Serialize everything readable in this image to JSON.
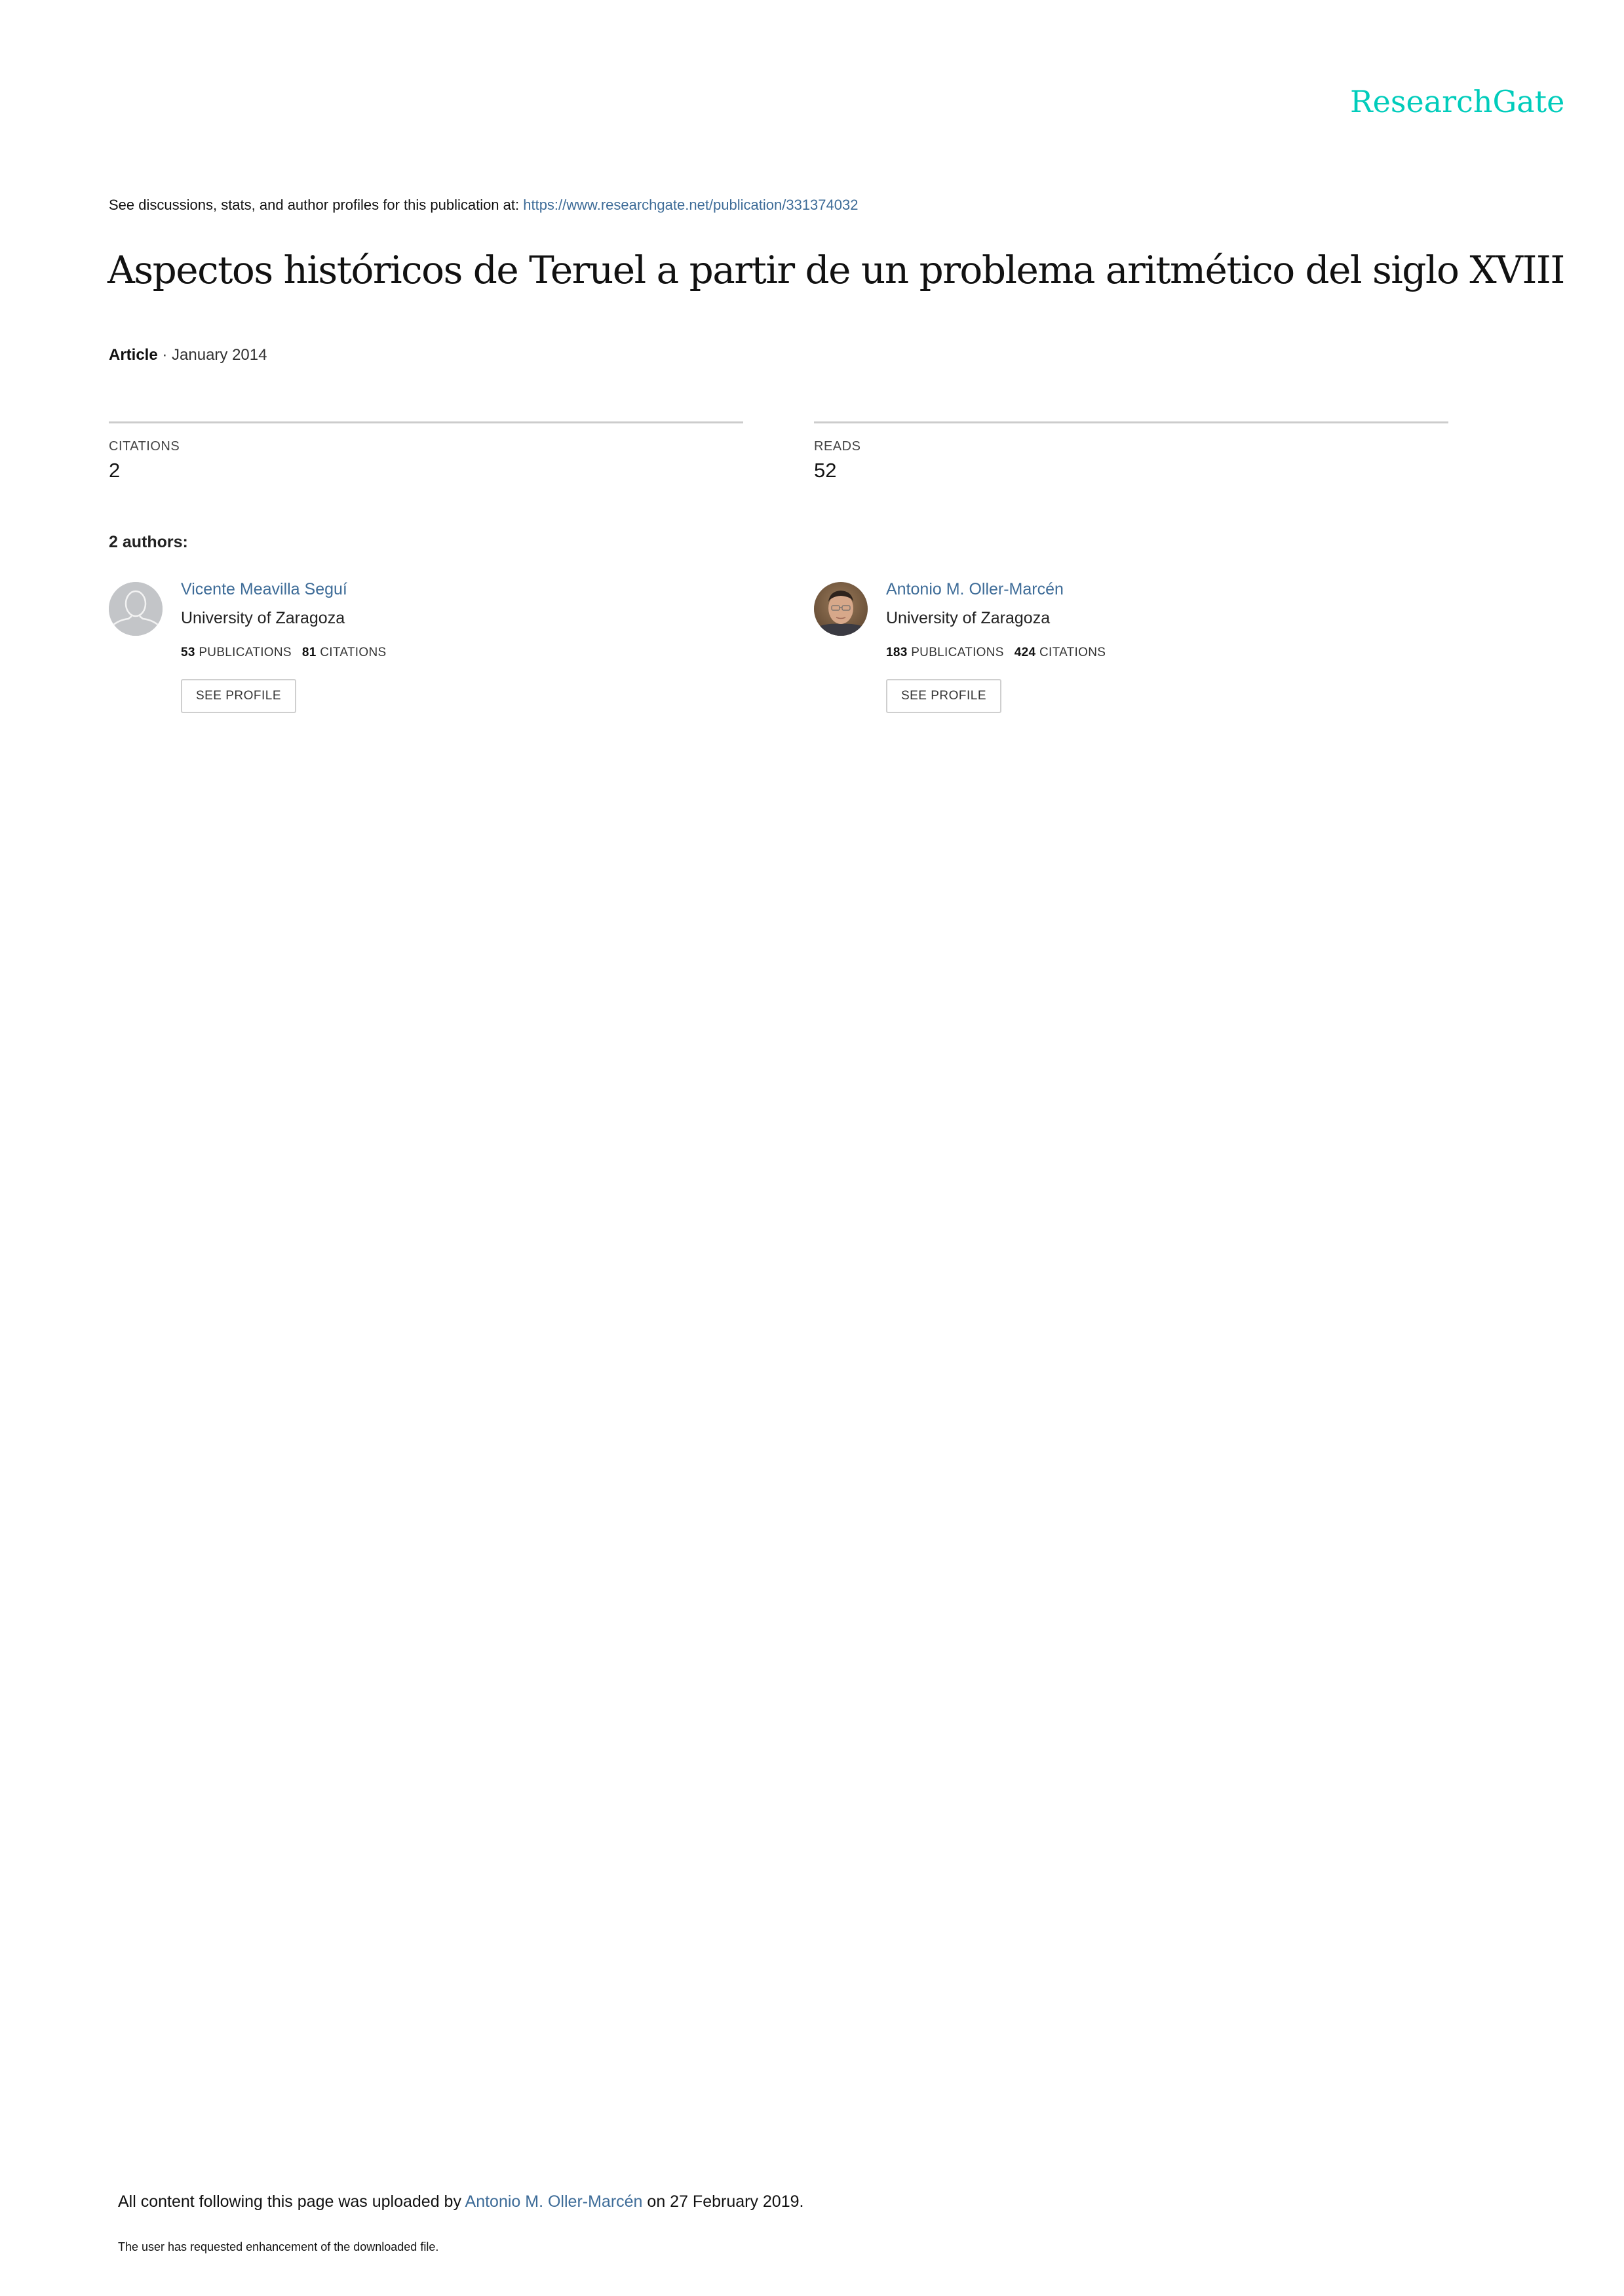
{
  "brand": {
    "name": "ResearchGate",
    "color": "#00ccbb"
  },
  "header": {
    "see_text": "See discussions, stats, and author profiles for this publication at: ",
    "publication_url": "https://www.researchgate.net/publication/331374032"
  },
  "publication": {
    "title": "Aspectos históricos de Teruel a partir de un problema aritmético del siglo XVIII",
    "type": "Article",
    "separator": " · ",
    "date": "January 2014"
  },
  "stats": {
    "citations_label": "CITATIONS",
    "citations_value": "2",
    "reads_label": "READS",
    "reads_value": "52"
  },
  "authors_section": {
    "heading": "2 authors:",
    "authors": [
      {
        "name": "Vicente Meavilla Seguí",
        "institution": "University of Zaragoza",
        "publications_count": "53",
        "publications_label": "PUBLICATIONS",
        "citations_count": "81",
        "citations_label": "CITATIONS",
        "button_label": "SEE PROFILE",
        "avatar": "default-user-silhouette-icon"
      },
      {
        "name": "Antonio M. Oller-Marcén",
        "institution": "University of Zaragoza",
        "publications_count": "183",
        "publications_label": "PUBLICATIONS",
        "citations_count": "424",
        "citations_label": "CITATIONS",
        "button_label": "SEE PROFILE",
        "avatar": "profile-photo"
      }
    ]
  },
  "footer": {
    "uploaded_prefix": "All content following this page was uploaded by ",
    "uploader": "Antonio M. Oller-Marcén",
    "uploaded_suffix": " on 27 February 2019.",
    "enhancement_note": "The user has requested enhancement of the downloaded file."
  },
  "colors": {
    "link": "#3e6c98",
    "rule": "#cccccc",
    "avatar_placeholder": "#c3c5c8"
  }
}
